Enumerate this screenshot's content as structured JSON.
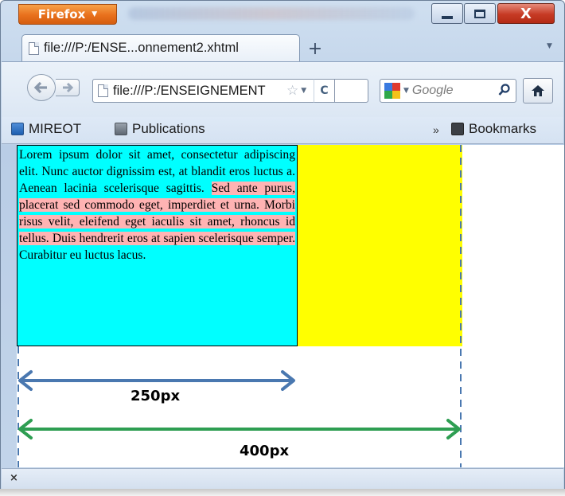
{
  "window": {
    "app_menu_label": "Firefox",
    "close_glyph": "X"
  },
  "tab": {
    "title": "file:///P:/ENSE...onnement2.xhtml",
    "new_tab_glyph": "+"
  },
  "navigation": {
    "url": "file:///P:/ENSEIGNEMENT",
    "reload_glyph": "C",
    "search_placeholder": "Google"
  },
  "bookmarks": {
    "items": [
      {
        "label": "MIREOT",
        "icon": "bookmark-page-icon"
      },
      {
        "label": "Publications",
        "icon": "bookmark-page-icon"
      }
    ],
    "overflow_glyph": "»",
    "bookmarks_menu_label": "Bookmarks"
  },
  "content": {
    "paragraph_parts": [
      "Lorem ipsum dolor sit amet, consectetur adipiscing elit. Nunc auctor dignissim est, at blandit eros luctus a. Aenean lacinia scelerisque sagittis. ",
      "Sed ante purus, placerat sed commodo eget, imperdiet et urna. Morbi risus velit, eleifend eget iaculis sit amet, rhoncus id tellus. Duis hendrerit eros at sapien scelerisque semper.",
      " Curabitur eu luctus lacus."
    ],
    "dimension_labels": {
      "inner": "250px",
      "outer": "400px"
    },
    "colors": {
      "text_box": "#00ffff",
      "highlight": "#ffb3b3",
      "outer_box": "#ffff00",
      "inner_arrow": "#4a78b0",
      "outer_arrow": "#2e9e52",
      "guide_line": "#4a78b0"
    }
  },
  "findbar": {
    "close_glyph": "×"
  }
}
